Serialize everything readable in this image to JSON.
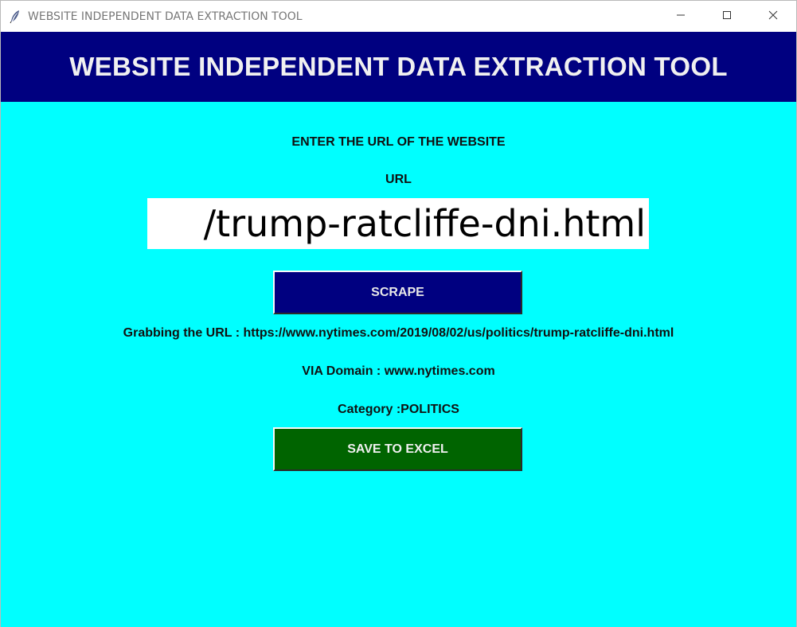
{
  "window": {
    "title": "WEBSITE INDEPENDENT DATA EXTRACTION TOOL",
    "app_icon": "feather-icon",
    "controls": [
      "minimize-icon",
      "maximize-icon",
      "close-icon"
    ]
  },
  "header": {
    "title": "WEBSITE INDEPENDENT DATA EXTRACTION TOOL",
    "background": "#000080",
    "color": "#f0f0f0"
  },
  "main": {
    "background": "#00ffff",
    "prompt": "ENTER THE URL OF THE WEBSITE",
    "url_label": "URL",
    "url_value": "/trump-ratcliffe-dni.html",
    "scrape_button": "SCRAPE",
    "grabbing_text": "Grabbing the URL : https://www.nytimes.com/2019/08/02/us/politics/trump-ratcliffe-dni.html",
    "domain_text": "VIA Domain : www.nytimes.com",
    "category_text": "Category :POLITICS",
    "save_button": "SAVE TO EXCEL"
  },
  "colors": {
    "scrape_button_bg": "#000080",
    "save_button_bg": "#006400"
  }
}
